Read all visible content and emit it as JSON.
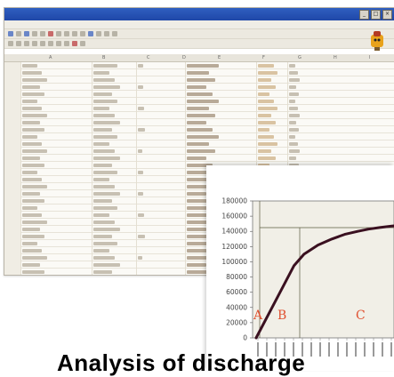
{
  "spreadsheet": {
    "title": "",
    "menu": [
      "",
      "",
      "",
      "",
      "",
      "",
      "",
      ""
    ],
    "columns": [
      "A",
      "B",
      "C",
      "D",
      "E",
      "F",
      "G",
      "H",
      "I"
    ]
  },
  "eg_label": "EG",
  "chart_data": {
    "type": "line",
    "title": "",
    "xlabel": "",
    "ylabel": "",
    "ylim": [
      0,
      180000
    ],
    "yticks": [
      0,
      20000,
      40000,
      60000,
      80000,
      100000,
      120000,
      140000,
      160000,
      180000
    ],
    "ytick_labels": [
      "0",
      "20000",
      "40000",
      "60000",
      "80000",
      "100000",
      "120000",
      "140000",
      "160000",
      "180000"
    ],
    "regions": [
      {
        "label": "A",
        "color": "#e05030"
      },
      {
        "label": "B",
        "color": "#e05030"
      },
      {
        "label": "C",
        "color": "#e05030"
      }
    ],
    "series": [
      {
        "x": [
          0,
          1,
          2,
          3,
          5,
          8,
          12,
          18,
          25,
          35,
          50,
          70,
          100
        ],
        "values": [
          0,
          60000,
          95000,
          110000,
          122000,
          130000,
          136000,
          140000,
          143000,
          145000,
          147000,
          148500,
          150000
        ]
      }
    ]
  },
  "caption": "Analysis of discharge"
}
